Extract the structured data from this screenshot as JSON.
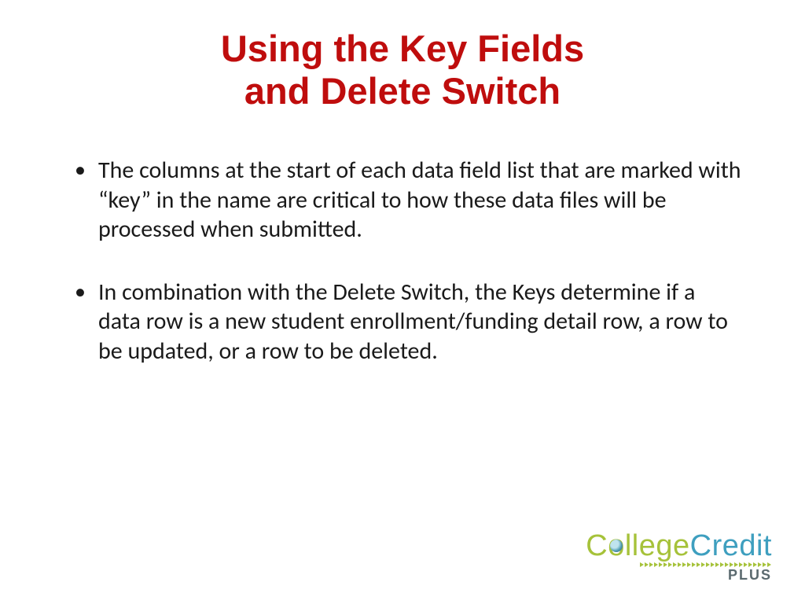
{
  "title_line1": "Using the Key Fields",
  "title_line2": "and Delete Switch",
  "bullets": [
    "The columns at the start of each data field list that are marked with “key” in the name are critical to how these data files will be processed when submitted.",
    "In combination with the Delete Switch, the Keys determine if a data row is a new student enrollment/funding detail row, a row to be updated, or a row to be deleted."
  ],
  "logo": {
    "c": "C",
    "o": "o",
    "llege": "llege",
    "credit": "Credit",
    "plus": "PLUS"
  }
}
